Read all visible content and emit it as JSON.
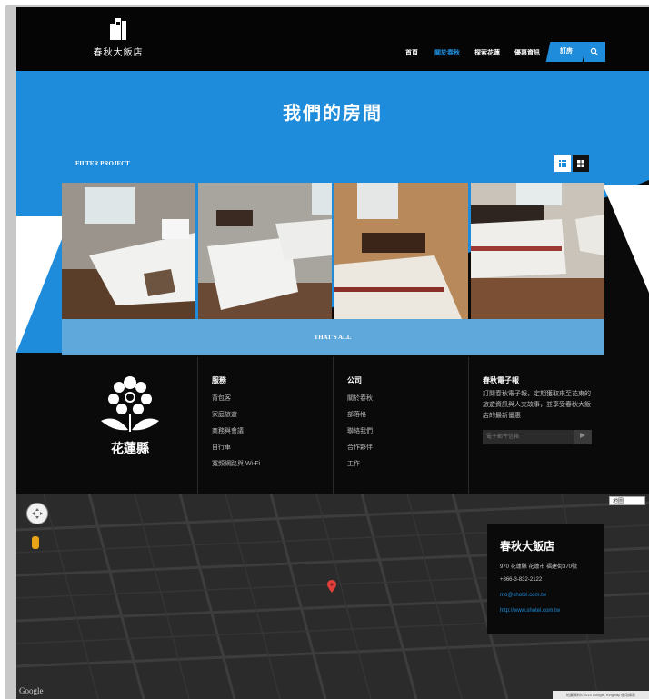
{
  "header": {
    "logo_text": "春秋大飯店",
    "nav": [
      "首頁",
      "關於春秋",
      "探索花蓮",
      "優惠資訊"
    ],
    "book_label": "訂房",
    "search_icon": "search-icon"
  },
  "banner": {
    "title": "我們的房間"
  },
  "filter": {
    "label": "FILTER PROJECT",
    "list_icon": "list-view-icon",
    "grid_icon": "grid-view-icon"
  },
  "rooms": [
    "room-photo-1",
    "room-photo-2",
    "room-photo-3",
    "room-photo-4"
  ],
  "more_label": "THAT'S ALL",
  "footer": {
    "logo_text": "花蓮縣",
    "services": {
      "title": "服務",
      "items": [
        "背包客",
        "家庭旅遊",
        "商務與會議",
        "自行車",
        "寬頻網路與 Wi-Fi"
      ]
    },
    "company": {
      "title": "公司",
      "items": [
        "關於春秋",
        "部落格",
        "聯絡我們",
        "合作夥伴",
        "工作"
      ]
    },
    "newsletter": {
      "title": "春秋電子報",
      "desc": "訂閱春秋電子報，定期獲取來至花東的旅遊資訊與人文故事，並享受春秋大飯店的最新優惠",
      "placeholder": "電子郵件信箱",
      "send_icon": "send-icon"
    }
  },
  "map": {
    "type_label": "地圖",
    "google_label": "Google",
    "attribution": "地圖資料©2014 Google, Kingway  使用條款",
    "card": {
      "name": "春秋大飯店",
      "address": "970 花蓮縣 花蓮市 福建街370號",
      "phone": "+866-3-832-2122",
      "email": "nfo@shotel.com.tw",
      "url": "http://www.shotel.com.tw"
    }
  }
}
